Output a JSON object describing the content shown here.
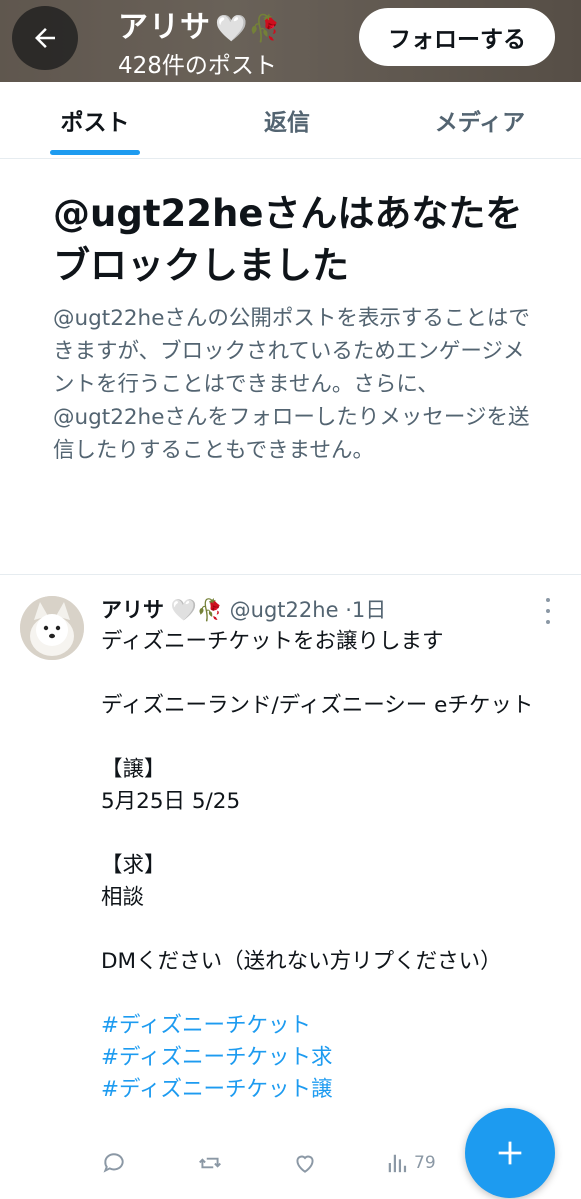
{
  "header": {
    "name": "アリサ",
    "name_emoji": "🤍🥀",
    "post_count": "428件のポスト",
    "follow_label": "フォローする"
  },
  "tabs": [
    {
      "label": "ポスト",
      "active": true
    },
    {
      "label": "返信",
      "active": false
    },
    {
      "label": "メディア",
      "active": false
    }
  ],
  "notice": {
    "title": "@ugt22heさんはあなたをブロックしました",
    "description": "@ugt22heさんの公開ポストを表示することはできますが、ブロックされているためエンゲージメントを行うことはできません。さらに、@ugt22heさんをフォローしたりメッセージを送信したりすることもできません。"
  },
  "post": {
    "author_name": "アリサ",
    "author_emoji": "🤍🥀",
    "handle": "@ugt22he",
    "dot": "·",
    "time": "1日",
    "lines": {
      "l1": "ディズニーチケットをお譲りします",
      "l2": "ディズニーランド/ディズニーシー eチケット",
      "l3": "【譲】",
      "l4": "5月25日 5/25",
      "l5": "【求】",
      "l6": "相談",
      "l7": "DMください（送れない方リプください）"
    },
    "hashtags": [
      "#ディズニーチケット",
      "#ディズニーチケット求",
      "#ディズニーチケット譲"
    ],
    "views": "79"
  },
  "colors": {
    "accent": "#1d9bf0",
    "text_primary": "#0f1419",
    "text_secondary": "#536471"
  }
}
